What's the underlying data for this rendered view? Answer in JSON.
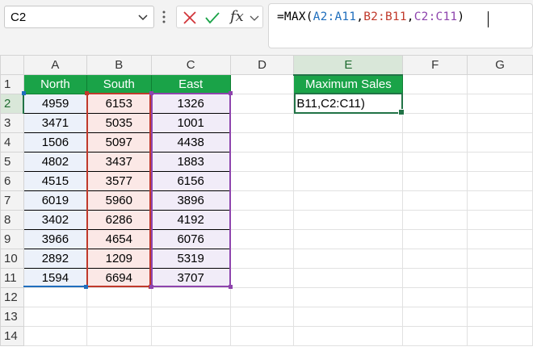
{
  "namebox": {
    "value": "C2"
  },
  "formula_bar": {
    "prefix": "=MAX(",
    "refA": "A2:A11",
    "sep1": ",",
    "refB": "B2:B11",
    "sep2": ",",
    "refC": "C2:C11",
    "suffix": ")",
    "fx_label": "fx"
  },
  "columns": [
    "A",
    "B",
    "C",
    "D",
    "E",
    "F",
    "G"
  ],
  "rows": [
    "1",
    "2",
    "3",
    "4",
    "5",
    "6",
    "7",
    "8",
    "9",
    "10",
    "11",
    "12",
    "13",
    "14"
  ],
  "headers": {
    "north": "North",
    "south": "South",
    "east": "East",
    "max_sales": "Maximum Sales"
  },
  "data": {
    "north": [
      "4959",
      "3471",
      "1506",
      "4802",
      "4515",
      "6019",
      "3402",
      "3966",
      "2892",
      "1594"
    ],
    "south": [
      "6153",
      "5035",
      "5097",
      "3437",
      "3577",
      "5960",
      "6286",
      "4654",
      "1209",
      "6694"
    ],
    "east": [
      "1326",
      "1001",
      "4438",
      "1883",
      "6156",
      "3896",
      "4192",
      "6076",
      "5319",
      "3707"
    ]
  },
  "edit_cell": {
    "text": "B11,C2:C11)"
  },
  "colors": {
    "header_green": "#1aa348",
    "ref_blue": "#1f6ebd",
    "ref_red": "#c0392b",
    "ref_purple": "#8e44ad",
    "select_green": "#217346"
  }
}
